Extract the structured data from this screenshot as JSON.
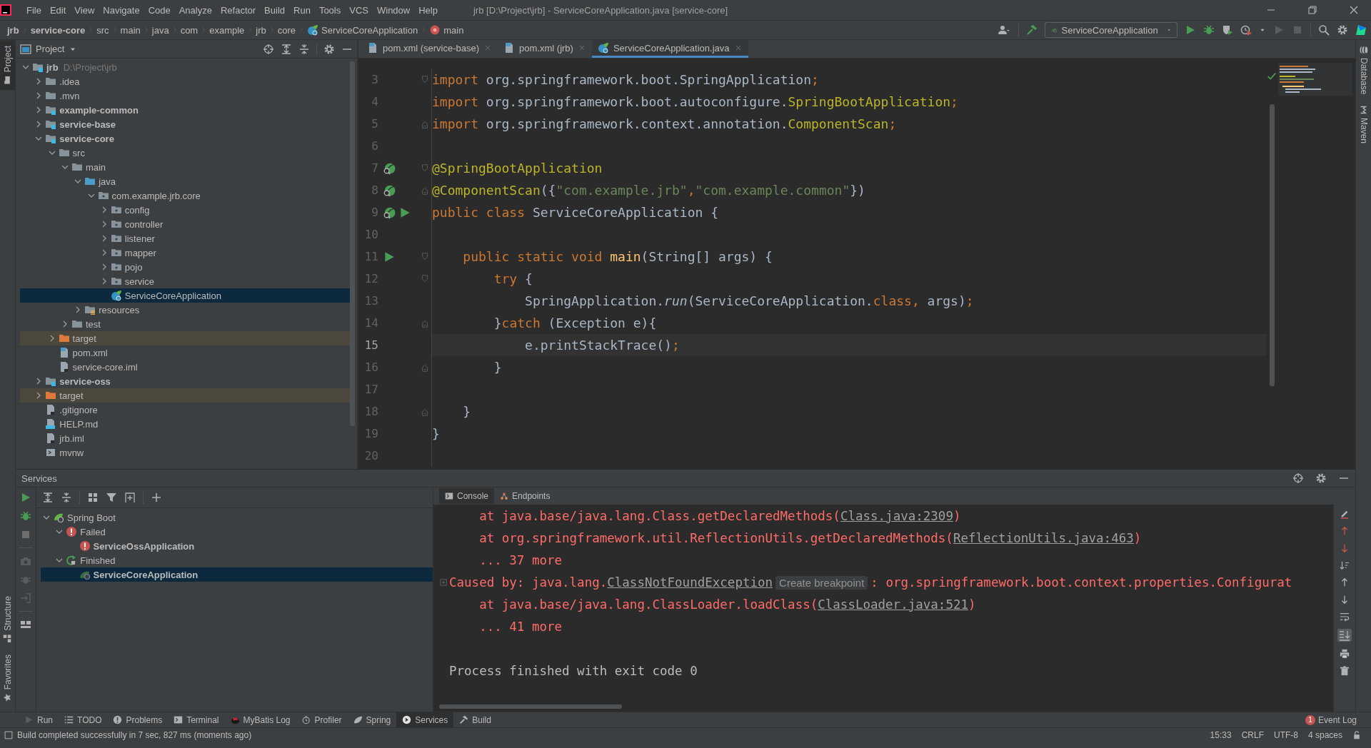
{
  "title_bar": {
    "menu": [
      "File",
      "Edit",
      "View",
      "Navigate",
      "Code",
      "Analyze",
      "Refactor",
      "Build",
      "Run",
      "Tools",
      "VCS",
      "Window",
      "Help"
    ],
    "title": "jrb [D:\\Project\\jrb] - ServiceCoreApplication.java [service-core]"
  },
  "breadcrumbs": [
    {
      "label": "jrb",
      "kind": "module"
    },
    {
      "label": "service-core",
      "kind": "module"
    },
    {
      "label": "src",
      "kind": "folder"
    },
    {
      "label": "main",
      "kind": "folder"
    },
    {
      "label": "java",
      "kind": "folder"
    },
    {
      "label": "com",
      "kind": "folder"
    },
    {
      "label": "example",
      "kind": "folder"
    },
    {
      "label": "jrb",
      "kind": "folder"
    },
    {
      "label": "core",
      "kind": "folder"
    },
    {
      "label": "ServiceCoreApplication",
      "kind": "class"
    },
    {
      "label": "main",
      "kind": "method"
    }
  ],
  "run_config": {
    "label": "ServiceCoreApplication"
  },
  "left_stripe": {
    "top": [
      {
        "label": "Project",
        "selected": true
      }
    ],
    "bottom": [
      {
        "label": "Structure",
        "selected": false
      },
      {
        "label": "Favorites",
        "selected": false
      }
    ]
  },
  "right_stripe": [
    {
      "label": "Database",
      "selected": false
    },
    {
      "label": "Maven",
      "selected": false
    }
  ],
  "project_panel": {
    "title": "Project",
    "tree": [
      {
        "label": "jrb",
        "detail": "D:\\Project\\jrb",
        "kind": "module",
        "expanded": true,
        "selected": false,
        "children": [
          {
            "label": ".idea",
            "kind": "folder",
            "expanded": false,
            "selected": false
          },
          {
            "label": ".mvn",
            "kind": "folder",
            "expanded": false,
            "selected": false
          },
          {
            "label": "example-common",
            "kind": "module",
            "expanded": false,
            "selected": false
          },
          {
            "label": "service-base",
            "kind": "module",
            "expanded": false,
            "selected": false
          },
          {
            "label": "service-core",
            "kind": "module",
            "expanded": true,
            "selected": false,
            "children": [
              {
                "label": "src",
                "kind": "folder",
                "expanded": true,
                "selected": false,
                "children": [
                  {
                    "label": "main",
                    "kind": "folder",
                    "expanded": true,
                    "selected": false,
                    "children": [
                      {
                        "label": "java",
                        "kind": "source",
                        "expanded": true,
                        "selected": false,
                        "children": [
                          {
                            "label": "com.example.jrb.core",
                            "kind": "package",
                            "expanded": true,
                            "selected": false,
                            "children": [
                              {
                                "label": "config",
                                "kind": "package",
                                "expanded": false,
                                "selected": false
                              },
                              {
                                "label": "controller",
                                "kind": "package",
                                "expanded": false,
                                "selected": false
                              },
                              {
                                "label": "listener",
                                "kind": "package",
                                "expanded": false,
                                "selected": false
                              },
                              {
                                "label": "mapper",
                                "kind": "package",
                                "expanded": false,
                                "selected": false
                              },
                              {
                                "label": "pojo",
                                "kind": "package",
                                "expanded": false,
                                "selected": false
                              },
                              {
                                "label": "service",
                                "kind": "package",
                                "expanded": false,
                                "selected": false
                              },
                              {
                                "label": "ServiceCoreApplication",
                                "kind": "spring-class",
                                "selected": true
                              }
                            ]
                          }
                        ]
                      },
                      {
                        "label": "resources",
                        "kind": "resources",
                        "expanded": false,
                        "selected": false
                      }
                    ]
                  },
                  {
                    "label": "test",
                    "kind": "folder",
                    "expanded": false,
                    "selected": false
                  }
                ]
              },
              {
                "label": "target",
                "kind": "excluded",
                "expanded": false,
                "selected": false
              },
              {
                "label": "pom.xml",
                "kind": "maven",
                "selected": false
              },
              {
                "label": "service-core.iml",
                "kind": "iml",
                "selected": false
              }
            ]
          },
          {
            "label": "service-oss",
            "kind": "module",
            "expanded": false,
            "selected": false
          },
          {
            "label": "target",
            "kind": "excluded",
            "expanded": false,
            "selected": false
          },
          {
            "label": ".gitignore",
            "kind": "gitignore",
            "selected": false
          },
          {
            "label": "HELP.md",
            "kind": "markdown",
            "selected": false
          },
          {
            "label": "jrb.iml",
            "kind": "iml",
            "selected": false
          },
          {
            "label": "mvnw",
            "kind": "script",
            "selected": false
          }
        ]
      }
    ]
  },
  "editor": {
    "tabs": [
      {
        "label": "pom.xml (service-base)",
        "kind": "maven",
        "selected": false
      },
      {
        "label": "pom.xml (jrb)",
        "kind": "maven",
        "selected": false
      },
      {
        "label": "ServiceCoreApplication.java",
        "kind": "spring-class",
        "selected": true
      }
    ],
    "lines": [
      {
        "number": "3",
        "current": false,
        "fold_start": true,
        "tokens": [
          {
            "text": "import ",
            "kind": "keyword"
          },
          {
            "text": "org.springframework.boot.SpringApplication",
            "kind": "plain"
          },
          {
            "text": ";",
            "kind": "keyword"
          }
        ]
      },
      {
        "number": "4",
        "current": false,
        "tokens": [
          {
            "text": "import ",
            "kind": "keyword"
          },
          {
            "text": "org.springframework.boot.autoconfigure.",
            "kind": "plain"
          },
          {
            "text": "SpringBootApplication",
            "kind": "annotation"
          },
          {
            "text": ";",
            "kind": "keyword"
          }
        ]
      },
      {
        "number": "5",
        "current": false,
        "fold_end": true,
        "tokens": [
          {
            "text": "import ",
            "kind": "keyword"
          },
          {
            "text": "org.springframework.context.annotation.",
            "kind": "plain"
          },
          {
            "text": "ComponentScan",
            "kind": "annotation"
          },
          {
            "text": ";",
            "kind": "keyword"
          }
        ]
      },
      {
        "number": "6",
        "current": false
      },
      {
        "number": "7",
        "current": false,
        "fold_start": true,
        "bean_marker": true,
        "tokens": [
          {
            "text": "@SpringBootApplication",
            "kind": "annotation"
          }
        ]
      },
      {
        "number": "8",
        "current": false,
        "fold_end": true,
        "bean_marker": true,
        "tokens": [
          {
            "text": "@ComponentScan",
            "kind": "annotation"
          },
          {
            "text": "({",
            "kind": "plain"
          },
          {
            "text": "\"com.example.jrb\"",
            "kind": "string"
          },
          {
            "text": ",",
            "kind": "keyword"
          },
          {
            "text": "\"com.example.common\"",
            "kind": "string"
          },
          {
            "text": "})",
            "kind": "plain"
          }
        ]
      },
      {
        "number": "9",
        "current": false,
        "bean_marker": true,
        "run_marker": true,
        "tokens": [
          {
            "text": "public class ",
            "kind": "keyword"
          },
          {
            "text": "ServiceCoreApplication {",
            "kind": "plain"
          }
        ]
      },
      {
        "number": "10",
        "current": false
      },
      {
        "number": "11",
        "current": false,
        "fold_start": true,
        "run_marker": true,
        "tokens": [
          {
            "text": "    public static void ",
            "kind": "keyword"
          },
          {
            "text": "main",
            "kind": "method"
          },
          {
            "text": "(String[] args) {",
            "kind": "plain"
          }
        ]
      },
      {
        "number": "12",
        "current": false,
        "fold_start": true,
        "tokens": [
          {
            "text": "        try ",
            "kind": "keyword"
          },
          {
            "text": "{",
            "kind": "plain"
          }
        ]
      },
      {
        "number": "13",
        "current": false,
        "tokens": [
          {
            "text": "            SpringApplication.",
            "kind": "plain"
          },
          {
            "text": "run",
            "kind": "static-call"
          },
          {
            "text": "(ServiceCoreApplication.",
            "kind": "plain"
          },
          {
            "text": "class, ",
            "kind": "keyword"
          },
          {
            "text": "args)",
            "kind": "plain"
          },
          {
            "text": ";",
            "kind": "keyword"
          }
        ]
      },
      {
        "number": "14",
        "current": false,
        "fold_end": true,
        "tokens": [
          {
            "text": "        }",
            "kind": "plain"
          },
          {
            "text": "catch ",
            "kind": "keyword"
          },
          {
            "text": "(Exception e){",
            "kind": "plain"
          }
        ]
      },
      {
        "number": "15",
        "current": true,
        "tokens": [
          {
            "text": "            e.printStackTrace()",
            "kind": "plain"
          },
          {
            "text": ";",
            "kind": "keyword"
          }
        ]
      },
      {
        "number": "16",
        "current": false,
        "fold_end": true,
        "tokens": [
          {
            "text": "        }",
            "kind": "plain"
          }
        ]
      },
      {
        "number": "17",
        "current": false
      },
      {
        "number": "18",
        "current": false,
        "fold_end": true,
        "tokens": [
          {
            "text": "    }",
            "kind": "plain"
          }
        ]
      },
      {
        "number": "19",
        "current": false,
        "tokens": [
          {
            "text": "}",
            "kind": "plain"
          }
        ]
      },
      {
        "number": "20",
        "current": false
      }
    ]
  },
  "services": {
    "title": "Services",
    "tree": [
      {
        "label": "Spring Boot",
        "kind": "group",
        "expanded": true,
        "selected": false,
        "children": [
          {
            "label": "Failed",
            "kind": "failed",
            "expanded": true,
            "selected": false,
            "children": [
              {
                "label": "ServiceOssApplication",
                "kind": "failed-app",
                "selected": false
              }
            ]
          },
          {
            "label": "Finished",
            "kind": "finished",
            "expanded": true,
            "selected": false,
            "children": [
              {
                "label": "ServiceCoreApplication",
                "kind": "app",
                "selected": true
              }
            ]
          }
        ]
      }
    ],
    "console_tabs": [
      {
        "label": "Console",
        "kind": "console",
        "selected": true
      },
      {
        "label": "Endpoints",
        "kind": "endpoints",
        "selected": false
      }
    ],
    "console_lines": [
      {
        "fold": false,
        "tokens": [
          {
            "text": "    at java.base/java.lang.Class.getDeclaredMethods(",
            "kind": "error"
          },
          {
            "text": "Class.java:2309",
            "kind": "link"
          },
          {
            "text": ")",
            "kind": "error"
          }
        ]
      },
      {
        "fold": false,
        "tokens": [
          {
            "text": "    at org.springframework.util.ReflectionUtils.getDeclaredMethods(",
            "kind": "error"
          },
          {
            "text": "ReflectionUtils.java:463",
            "kind": "link"
          },
          {
            "text": ")",
            "kind": "error"
          }
        ]
      },
      {
        "fold": false,
        "tokens": [
          {
            "text": "    ... 37 more",
            "kind": "error"
          }
        ]
      },
      {
        "fold": true,
        "tokens": [
          {
            "text": "Caused by: java.lang.",
            "kind": "error"
          },
          {
            "text": "ClassNotFoundException",
            "kind": "link"
          },
          {
            "text": "Create breakpoint",
            "kind": "hint"
          },
          {
            "text": ": org.springframework.boot.context.properties.Configurat",
            "kind": "error"
          }
        ]
      },
      {
        "fold": false,
        "tokens": [
          {
            "text": "    at java.base/java.lang.ClassLoader.loadClass(",
            "kind": "error"
          },
          {
            "text": "ClassLoader.java:521",
            "kind": "link"
          },
          {
            "text": ")",
            "kind": "error"
          }
        ]
      },
      {
        "fold": false,
        "tokens": [
          {
            "text": "    ... 41 more",
            "kind": "error"
          }
        ]
      },
      {
        "fold": false
      },
      {
        "fold": false,
        "tokens": [
          {
            "text": "Process finished with exit code 0",
            "kind": "plain"
          }
        ]
      }
    ]
  },
  "tool_windows": [
    {
      "label": "Run",
      "kind": "run",
      "selected": false
    },
    {
      "label": "TODO",
      "kind": "todo",
      "selected": false
    },
    {
      "label": "Problems",
      "kind": "problems",
      "selected": false
    },
    {
      "label": "Terminal",
      "kind": "terminal",
      "selected": false
    },
    {
      "label": "MyBatis Log",
      "kind": "bird",
      "selected": false
    },
    {
      "label": "Profiler",
      "kind": "profiler",
      "selected": false
    },
    {
      "label": "Spring",
      "kind": "spring",
      "selected": false
    },
    {
      "label": "Services",
      "kind": "services",
      "selected": true
    },
    {
      "label": "Build",
      "kind": "build",
      "selected": false
    }
  ],
  "event_log": {
    "label": "Event Log",
    "count": "1"
  },
  "status_bar": {
    "message": "Build completed successfully in 7 sec, 827 ms (moments ago)",
    "items": [
      "15:33",
      "CRLF",
      "UTF-8",
      "4 spaces"
    ]
  }
}
